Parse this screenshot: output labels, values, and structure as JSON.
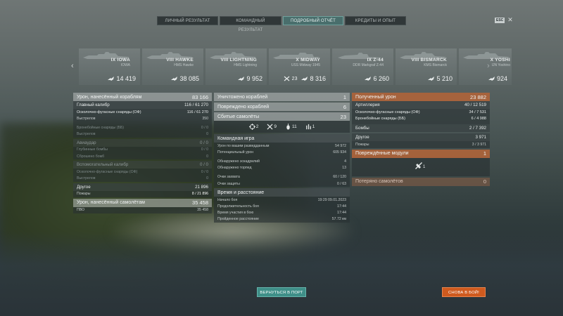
{
  "tabs": [
    {
      "label": "ЛИЧНЫЙ РЕЗУЛЬТАТ",
      "active": false
    },
    {
      "label": "КОМАНДНЫЙ РЕЗУЛЬТАТ",
      "active": false
    },
    {
      "label": "ПОДРОБНЫЙ ОТЧЁТ",
      "active": true
    },
    {
      "label": "КРЕДИТЫ И ОПЫТ",
      "active": false
    }
  ],
  "topright": {
    "badge": "ESC",
    "close": "✕"
  },
  "ships": [
    {
      "name": "IX IOWA",
      "sub": "IOWA",
      "damage": "14 419",
      "kills": ""
    },
    {
      "name": "VIII HAWKE",
      "sub": "HMS Hawke",
      "damage": "38 085",
      "kills": ""
    },
    {
      "name": "VIII LIGHTNING",
      "sub": "HMS Lightning",
      "damage": "9 952",
      "kills": ""
    },
    {
      "name": "X MIDWAY",
      "sub": "USS Midway 1945",
      "damage": "8 316",
      "kills": "23"
    },
    {
      "name": "IX Z-44",
      "sub": "DDR Markgraf Z-44",
      "damage": "6 260",
      "kills": ""
    },
    {
      "name": "VIII BISMARCK",
      "sub": "KMS Bismarck",
      "damage": "5 210",
      "kills": ""
    },
    {
      "name": "X YOSHI",
      "sub": "IJN Yoshino",
      "damage": "924",
      "kills": ""
    }
  ],
  "col1": {
    "main": {
      "label": "Урон, нанесённый кораблям",
      "value": "83 166"
    },
    "main_caliber": {
      "label": "Главный калибр",
      "value": "116 / 61 270"
    },
    "he_label": "Осколочно-фугасные снаряды (ОФ)",
    "he_value": "116 / 61 270",
    "shots_label": "Выстрелов",
    "shots_value": "350",
    "ap_label": "Бронебойные снаряды (ББ)",
    "ap_value": "0 / 0",
    "hits_label": "Выстрелов",
    "hits_value": "0",
    "air": {
      "label": "Авиаудар",
      "value": "0 / 0"
    },
    "depth_label": "Глубинные бомбы",
    "depth_value": "0 / 0",
    "dropped_label": "Сброшено бомб",
    "dropped_value": "0",
    "secondary": {
      "label": "Вспомогательный калибр",
      "value": "0 / 0"
    },
    "sec_he_label": "Осколочно-фугасные снаряды (ОФ)",
    "sec_he_value": "0 / 0",
    "sec_shots_label": "Выстрелов",
    "sec_shots_value": "0",
    "other": {
      "label": "Другое",
      "value": "21 896"
    },
    "fires_label": "Пожары",
    "fires_value": "8 / 21 896",
    "planes": {
      "label": "Урон, нанесённый самолётам",
      "value": "35 458"
    },
    "aa_label": "ПВО",
    "aa_value": "35 458"
  },
  "col2": {
    "destroyed": {
      "label": "Уничтожено кораблей",
      "value": "1"
    },
    "damaged": {
      "label": "Повреждено кораблей",
      "value": "6"
    },
    "planes_down": {
      "label": "Сбитые самолёты",
      "value": "23"
    },
    "icons": [
      {
        "name": "spotted-icon",
        "value": "2"
      },
      {
        "name": "planes-shot-icon",
        "value": "9"
      },
      {
        "name": "bomb-icon",
        "value": "11"
      },
      {
        "name": "rocket-icon",
        "value": "1"
      }
    ],
    "team": {
      "label": "Командная игра"
    },
    "spot_dmg_label": "Урон по вашим разведданным",
    "spot_dmg_value": "54 972",
    "potential_label": "Потенциальный урон",
    "potential_value": "605 934",
    "squads_label": "Обнаружено эскадрилий",
    "squads_value": "4",
    "torps_label": "Обнаружено торпед",
    "torps_value": "13",
    "capture_label": "Очки захвата",
    "capture_value": "60 / 120",
    "defense_label": "Очки защиты",
    "defense_value": "0 / 63",
    "time": {
      "label": "Время и расстояние"
    },
    "start_label": "Начало боя",
    "start_value": "19:29  09.01.2023",
    "duration_label": "Продолжительность боя",
    "duration_value": "17:44",
    "participation_label": "Время участия в бою",
    "participation_value": "17:44",
    "distance_label": "Пройденное расстояние",
    "distance_value": "57.72 км"
  },
  "col3": {
    "received": {
      "label": "Полученный урон",
      "value": "23 882"
    },
    "artillery": {
      "label": "Артиллерия",
      "value": "40 / 12 519"
    },
    "he_label": "Осколочно-фугасные снаряды (ОФ)",
    "he_value": "34 / 7 531",
    "ap_label": "Бронебойные снаряды (ББ)",
    "ap_value": "6 / 4 988",
    "bombs": {
      "label": "Бомбы",
      "value": "2 / 7 392"
    },
    "other": {
      "label": "Другое",
      "value": "3 971"
    },
    "fires_label": "Пожары",
    "fires_value": "3 / 3 971",
    "modules": {
      "label": "Повреждённые модули",
      "value": "1"
    },
    "module_count": "1",
    "lost_planes": {
      "label": "Потеряно самолётов",
      "value": "0"
    }
  },
  "buttons": {
    "port": "ВЕРНУТЬСЯ В ПОРТ",
    "battle": "СНОВА В БОЙ!"
  }
}
